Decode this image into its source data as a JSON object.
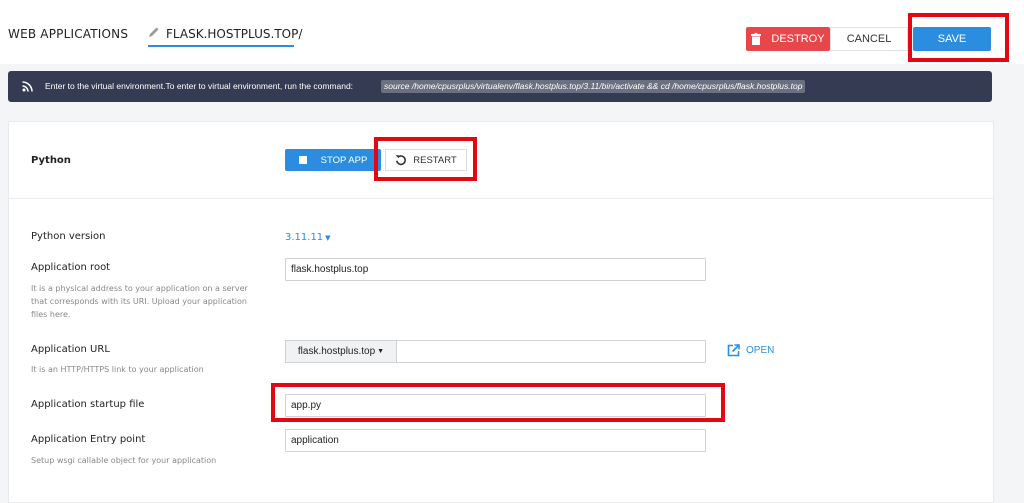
{
  "header": {
    "title": "WEB APPLICATIONS",
    "breadcrumb": "FLASK.HOSTPLUS.TOP/",
    "destroy_label": "DESTROY",
    "cancel_label": "CANCEL",
    "save_label": "SAVE"
  },
  "banner": {
    "text": "Enter to the virtual environment.To enter to virtual environment, run the command:",
    "command": "source /home/cpusrplus/virtualenv/flask.hostplus.top/3.11/bin/activate && cd /home/cpusrplus/flask.hostplus.top"
  },
  "app": {
    "section_title": "Python",
    "stop_label": "STOP APP",
    "restart_label": "RESTART"
  },
  "form": {
    "python_version": {
      "label": "Python version",
      "value": "3.11.11"
    },
    "app_root": {
      "label": "Application root",
      "value": "flask.hostplus.top",
      "help": "It is a physical address to your application on a server that corresponds with its URI. Upload your application files here."
    },
    "app_url": {
      "label": "Application URL",
      "domain": "flask.hostplus.top",
      "path": "",
      "help": "It is an HTTP/HTTPS link to your application",
      "open_label": "OPEN"
    },
    "startup_file": {
      "label": "Application startup file",
      "value": "app.py"
    },
    "entry_point": {
      "label": "Application Entry point",
      "value": "application",
      "help": "Setup wsgi callable object for your application"
    }
  },
  "colors": {
    "accent": "#2b8ddf",
    "danger": "#e8474a",
    "banner": "#353b52",
    "highlight": "#e30613"
  }
}
